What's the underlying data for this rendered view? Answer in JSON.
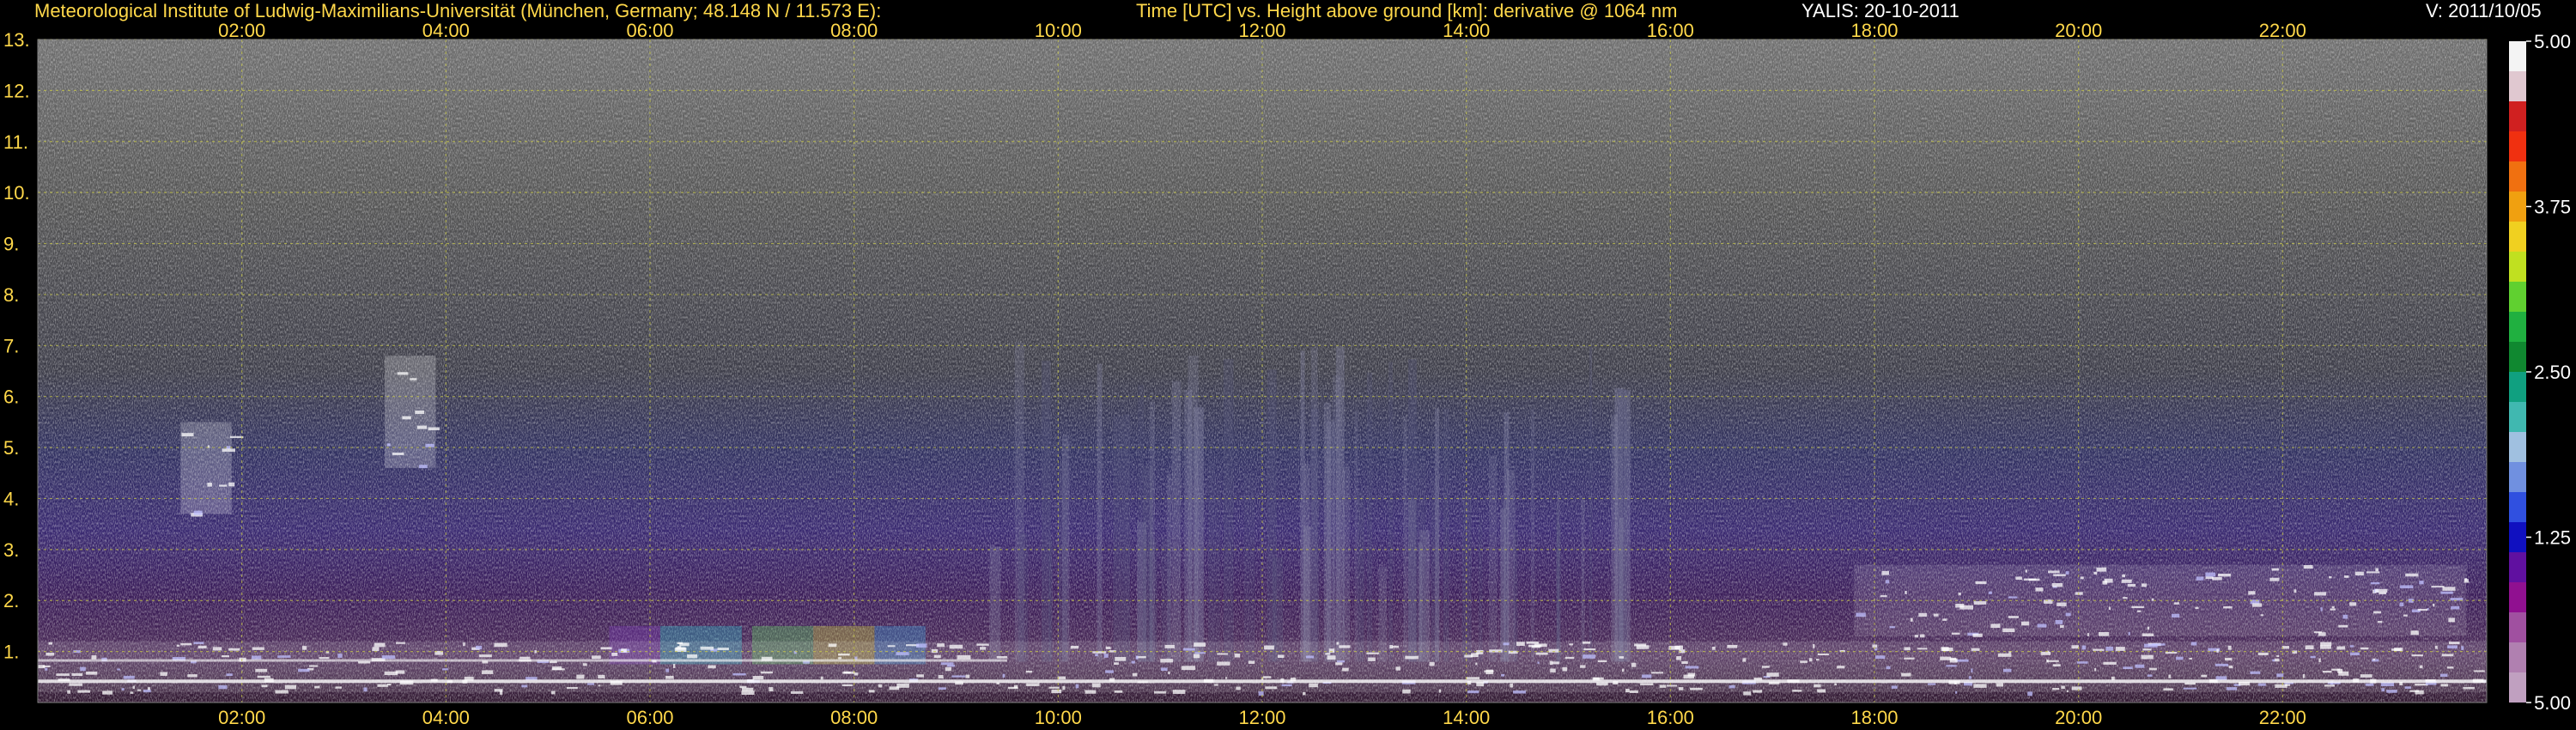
{
  "header": {
    "institute": "Meteorological Institute of Ludwig-Maximilians-Universität (München, Germany; 48.148 N / 11.573 E):",
    "title": "Time [UTC] vs. Height above ground [km]: derivative @ 1064 nm",
    "instrument_date": "YALIS: 20-10-2011",
    "version": "V: 2011/10/05"
  },
  "colors": {
    "header_text": "#ffd84a",
    "instrument_text": "#ffffff",
    "axis_label": "#ffd84a",
    "gridline": "#c8c84a",
    "background": "#000000"
  },
  "chart_data": {
    "type": "heatmap",
    "title": "Time [UTC] vs. Height above ground [km]: derivative @ 1064 nm",
    "xlabel": "Time [UTC]",
    "ylabel": "Height above ground [km]",
    "xlim": [
      0,
      24
    ],
    "ylim": [
      0,
      13
    ],
    "x_ticks": [
      2,
      4,
      6,
      8,
      10,
      12,
      14,
      16,
      18,
      20,
      22
    ],
    "x_tick_labels": [
      "02:00",
      "04:00",
      "06:00",
      "08:00",
      "10:00",
      "12:00",
      "14:00",
      "16:00",
      "18:00",
      "20:00",
      "22:00"
    ],
    "y_ticks": [
      1,
      2,
      3,
      4,
      5,
      6,
      7,
      8,
      9,
      10,
      11,
      12,
      13
    ],
    "y_tick_labels": [
      "1.",
      "2.",
      "3.",
      "4.",
      "5.",
      "6.",
      "7.",
      "8.",
      "9.",
      "10.",
      "11.",
      "12.",
      "13."
    ],
    "grid": true,
    "colorbar": {
      "tick_labels": [
        "5.00",
        "3.75",
        "2.50",
        "1.25",
        "5.00"
      ],
      "tick_positions": [
        1.0,
        0.75,
        0.5,
        0.25,
        0.0
      ],
      "colors": [
        "#f4f4f4",
        "#e0c8d0",
        "#d02020",
        "#f03010",
        "#f07010",
        "#f0a010",
        "#f0d020",
        "#c0e020",
        "#60d030",
        "#20b040",
        "#108830",
        "#10a080",
        "#40b8b0",
        "#a0c0e0",
        "#7090e0",
        "#3050e0",
        "#1010c0",
        "#6010a0",
        "#901090",
        "#a050a0",
        "#b080b0",
        "#c0a0c0"
      ]
    },
    "features": [
      {
        "name": "boundary layer aerosol",
        "x_range": [
          0,
          24
        ],
        "height_km": [
          0.2,
          1.2
        ]
      },
      {
        "name": "cloud",
        "x_range": [
          1.4,
          1.9
        ],
        "height_km": [
          3.7,
          5.5
        ]
      },
      {
        "name": "cloud",
        "x_range": [
          3.4,
          3.9
        ],
        "height_km": [
          4.6,
          6.8
        ]
      },
      {
        "name": "cloud layer",
        "x_range": [
          17.8,
          23.8
        ],
        "height_km": [
          1.3,
          2.7
        ]
      }
    ]
  }
}
